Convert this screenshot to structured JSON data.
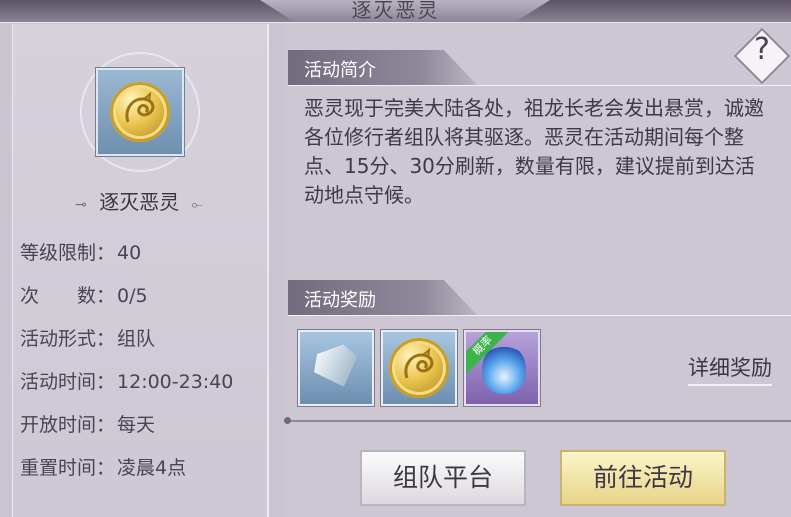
{
  "window": {
    "title": "逐灭恶灵"
  },
  "left": {
    "activity_name": "逐灭恶灵",
    "ornament_left": "⊸",
    "ornament_right": "⟜",
    "rows": [
      {
        "label": "等级限制：",
        "value": "40"
      },
      {
        "label": "次　　数：",
        "value": "0/5"
      },
      {
        "label": "活动形式：",
        "value": "组队"
      },
      {
        "label": "活动时间：",
        "value": "12:00-23:40"
      },
      {
        "label": "开放时间：",
        "value": "每天"
      },
      {
        "label": "重置时间：",
        "value": "凌晨4点"
      }
    ]
  },
  "intro": {
    "header": "活动简介",
    "text": "恶灵现于完美大陆各处，祖龙长老会发出悬赏，诚邀各位修行者组队将其驱逐。恶灵在活动期间每个整点、15分、30分刷新，数量有限，建议提前到达活动地点守候。",
    "help_label": "?"
  },
  "rewards": {
    "header": "活动奖励",
    "items": [
      {
        "icon": "diamond-icon"
      },
      {
        "icon": "gold-coin-icon"
      },
      {
        "icon": "blue-flame-icon",
        "badge": "概率"
      }
    ],
    "detail_label": "详细奖励"
  },
  "buttons": {
    "team_platform": "组队平台",
    "go_activity": "前往活动"
  }
}
